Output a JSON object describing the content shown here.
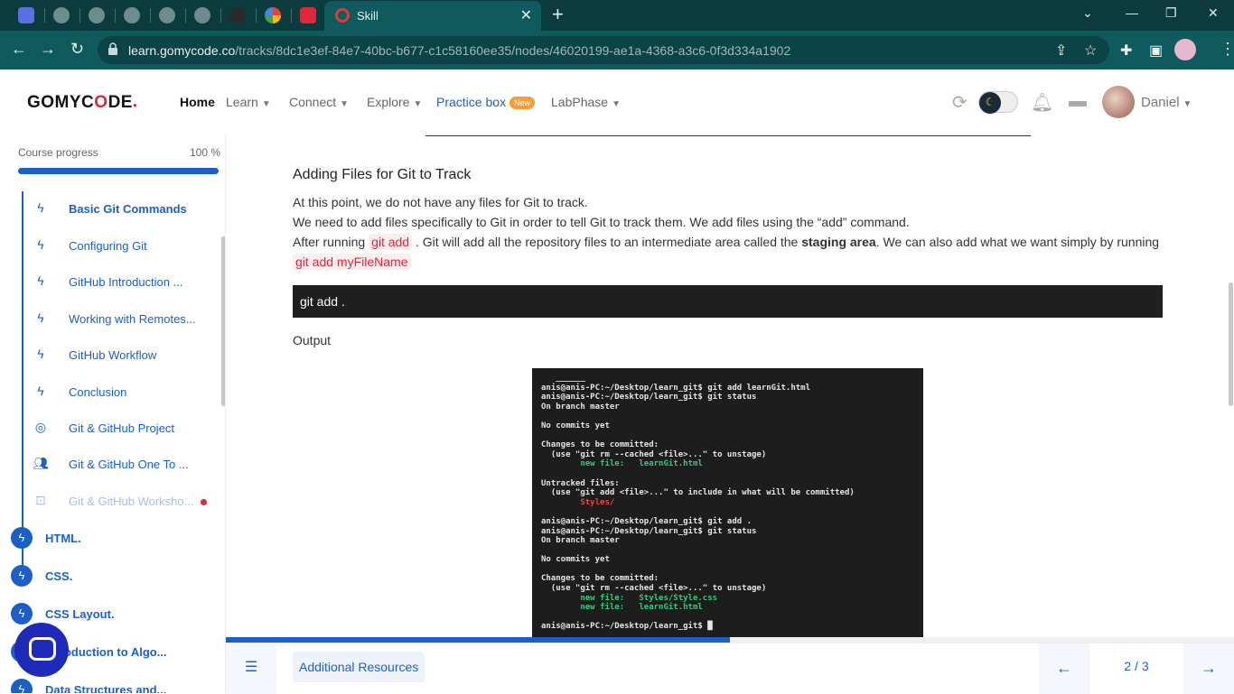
{
  "browser": {
    "active_tab_title": "Skill",
    "url_host": "learn.gomycode.co",
    "url_path": "/tracks/8dc1e3ef-84e7-40bc-b677-c1c58160ee35/nodes/46020199-ae1a-4368-a3c6-0f3d334a1902"
  },
  "header": {
    "logo_left": "GOMYC",
    "logo_o": "O",
    "logo_right": "DE",
    "nav": {
      "home": "Home",
      "learn": "Learn",
      "connect": "Connect",
      "explore": "Explore",
      "practice": "Practice box",
      "practice_badge": "New",
      "labphase": "LabPhase"
    },
    "user_name": "Daniel"
  },
  "sidebar": {
    "progress_label": "Course progress",
    "progress_pct": "100 %",
    "progress_value": 1.0,
    "lessons": [
      {
        "label": "Basic Git Commands",
        "icon": "bolt-icon"
      },
      {
        "label": "Configuring Git",
        "icon": "bolt-icon"
      },
      {
        "label": "GitHub Introduction ...",
        "icon": "bolt-icon"
      },
      {
        "label": "Working with Remotes...",
        "icon": "bolt-icon"
      },
      {
        "label": "GitHub Workflow",
        "icon": "bolt-icon"
      },
      {
        "label": "Conclusion",
        "icon": "bolt-icon"
      },
      {
        "label": "Git & GitHub Project",
        "icon": "target-icon"
      },
      {
        "label": "Git & GitHub One To ...",
        "icon": "people-icon"
      },
      {
        "label": "Git & GitHub Worksho...",
        "icon": "workshop-icon"
      }
    ],
    "sections": [
      {
        "label": "HTML."
      },
      {
        "label": "CSS."
      },
      {
        "label": "CSS Layout."
      },
      {
        "label": "Introduction to Algo..."
      },
      {
        "label": "Data Structures and..."
      }
    ]
  },
  "content": {
    "title": "Adding Files for Git to Track",
    "p1": "At this point, we do not have any files for Git to track.",
    "p2": "We need to add files specifically to Git in order to tell Git to track them. We add files using the “add” command.",
    "p3_a": "After running ",
    "p3_code1": "git add",
    "p3_b": " . Git will add all the repository files to an intermediate area called the ",
    "p3_bold": "staging area",
    "p3_c": ". We can also add what we want simply by running",
    "p3_code2": "git add myFileName",
    "codeblock": "git add .",
    "output_label": "Output",
    "terminal_lines": [
      {
        "text": "   ______",
        "color": "white"
      },
      {
        "text": "anis@anis-PC:~/Desktop/learn_git$ git add learnGit.html",
        "color": "white"
      },
      {
        "text": "anis@anis-PC:~/Desktop/learn_git$ git status",
        "color": "white"
      },
      {
        "text": "On branch master",
        "color": "white"
      },
      {
        "text": "",
        "color": "white"
      },
      {
        "text": "No commits yet",
        "color": "white"
      },
      {
        "text": "",
        "color": "white"
      },
      {
        "text": "Changes to be committed:",
        "color": "white"
      },
      {
        "text": "  (use \"git rm --cached <file>...\" to unstage)",
        "color": "white"
      },
      {
        "text": "        new file:   learnGit.html",
        "color": "green"
      },
      {
        "text": "",
        "color": "white"
      },
      {
        "text": "Untracked files:",
        "color": "white"
      },
      {
        "text": "  (use \"git add <file>...\" to include in what will be committed)",
        "color": "white"
      },
      {
        "text": "        Styles/",
        "color": "red"
      },
      {
        "text": "",
        "color": "white"
      },
      {
        "text": "anis@anis-PC:~/Desktop/learn_git$ git add .",
        "color": "white"
      },
      {
        "text": "anis@anis-PC:~/Desktop/learn_git$ git status",
        "color": "white"
      },
      {
        "text": "On branch master",
        "color": "white"
      },
      {
        "text": "",
        "color": "white"
      },
      {
        "text": "No commits yet",
        "color": "white"
      },
      {
        "text": "",
        "color": "white"
      },
      {
        "text": "Changes to be committed:",
        "color": "white"
      },
      {
        "text": "  (use \"git rm --cached <file>...\" to unstage)",
        "color": "white"
      },
      {
        "text": "        new file:   Styles/Style.css",
        "color": "green"
      },
      {
        "text": "        new file:   learnGit.html",
        "color": "green"
      },
      {
        "text": "",
        "color": "white"
      },
      {
        "text": "anis@anis-PC:~/Desktop/learn_git$ █",
        "color": "white"
      }
    ]
  },
  "bottom": {
    "resources": "Additional Resources",
    "page": "2 / 3",
    "progress_value": 0.5
  },
  "colors": {
    "brand_blue": "#1d5fc9",
    "brand_red": "#e0263c",
    "chrome_dark": "#0b3b3d",
    "chrome_teal": "#0e5a5c"
  }
}
